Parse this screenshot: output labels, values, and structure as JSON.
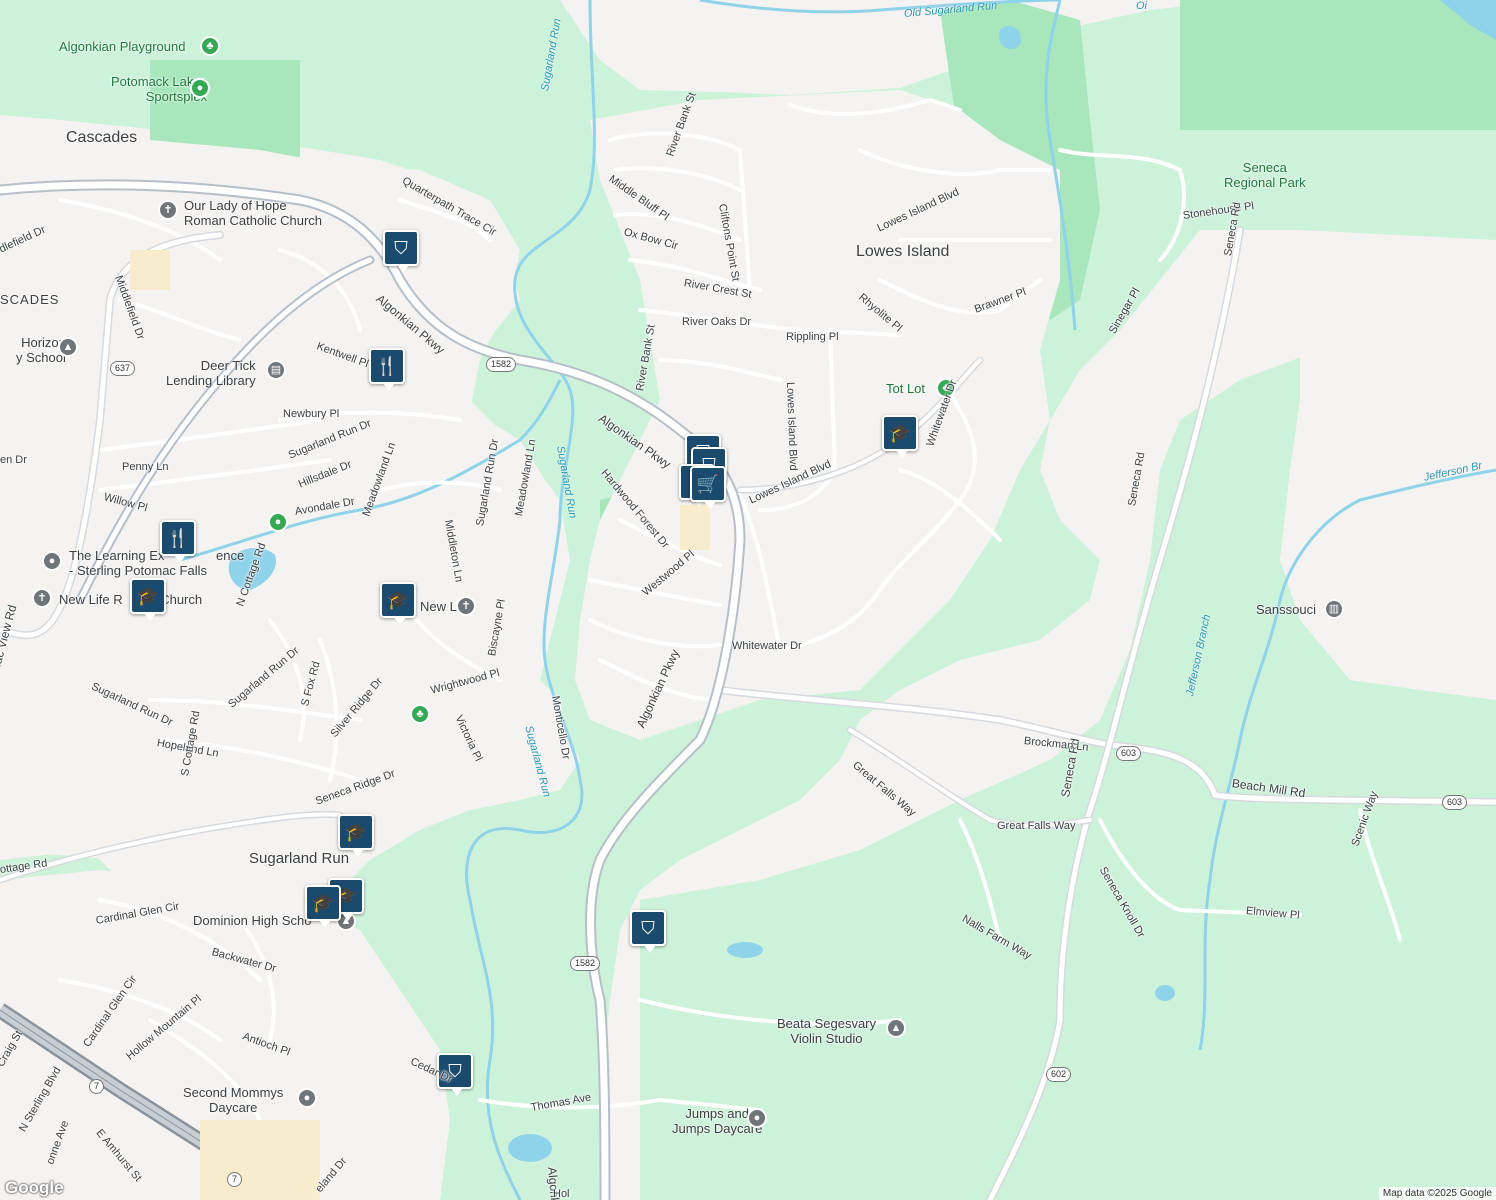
{
  "places": {
    "cascades": "Cascades",
    "cascades_partial": "SCADES",
    "lowes_island": "Lowes Island",
    "sugarland_run": "Sugarland Run"
  },
  "pois": {
    "algonkian_playground": "Algonkian Playground",
    "potomack_lakes_1": "Potomack Lakes",
    "potomack_lakes_2": "Sportsplex",
    "our_lady_1": "Our Lady of Hope",
    "our_lady_2": "Roman Catholic Church",
    "horizon_1": "Horizon",
    "horizon_2": "y School",
    "deer_tick_1": "Deer Tick",
    "deer_tick_2": "Lending Library",
    "learning_1": "The Learning Ex",
    "learning_2": "ence",
    "learning_3": "- Sterling Potomac Falls",
    "new_life_1": "New Life R",
    "new_life_2": "Church",
    "new_life_3": "New Life!",
    "tot_lot": "Tot Lot",
    "seneca_park_1": "Seneca",
    "seneca_park_2": "Regional Park",
    "sanssouci": "Sanssouci",
    "dominion": "Dominion High Scho",
    "beata_1": "Beata Segesvary",
    "beata_2": "Violin Studio",
    "second_mommys_1": "Second Mommys",
    "second_mommys_2": "Daycare",
    "jumps_1": "Jumps and",
    "jumps_2": "Jumps Daycare"
  },
  "streets": {
    "quarterpath": "Quarterpath Trace Cir",
    "algonkian_pkwy": "Algonkian Pkwy",
    "algonkian_pkwy_mid": "Algonkian Pkwy",
    "algonkian_pkwy_center": "Algonkian Pkwy",
    "algonkian_pkwy_south": "Algonkian Pkwy",
    "kentwell": "Kentwell Pl",
    "newbury": "Newbury Pl",
    "sugarland_run_dr": "Sugarland Run Dr",
    "hillsdale": "Hillsdale Dr",
    "avondale": "Avondale Dr",
    "penny": "Penny Ln",
    "willow": "Willow Pl",
    "middlefield": "Middlefield Dr",
    "middlefield_partial": "dlefield Dr",
    "en_dr": "en Dr",
    "meadowland_ln": "Meadowland Ln",
    "middleton": "Middleton Ln",
    "sugarland_run_dr_v": "Sugarland Run Dr",
    "meadowland_ln2": "Meadowland Ln",
    "n_cottage": "N Cottage Rd",
    "potomac_view": "Potomac View Rd",
    "sugarland_run_dr2": "Sugarland Run Dr",
    "sugarland_run_dr3": "Sugarland Run Dr",
    "s_fox": "S Fox Rd",
    "silver_ridge": "Silver Ridge Dr",
    "wrightwood": "Wrightwood Pl",
    "victoria": "Victoria Pl",
    "biscayne": "Biscayne Pl",
    "hopeland": "Hopeland Ln",
    "s_cottage": "S Cottage Rd",
    "seneca_ridge": "Seneca Ridge Dr",
    "cottage_rd": "ottage Rd",
    "cardinal_glen": "Cardinal Glen Cir",
    "cardinal_glen2": "Cardinal Glen Cir",
    "backwater": "Backwater Dr",
    "hollow_mountain": "Hollow Mountain Pl",
    "antioch": "Antioch Pl",
    "n_sterling": "N Sterling Blvd",
    "e_amhurst": "E Amhurst St",
    "craig": "Craig St",
    "onne_ave": "onne Ave",
    "cedar": "Cedar Dr",
    "thomas": "Thomas Ave",
    "river_bank_st": "River Bank St",
    "middle_bluff": "Middle Bluff Pl",
    "cliftons_point": "Cliftons Point St",
    "ox_bow": "Ox Bow Cir",
    "river_crest": "River Crest St",
    "river_oaks": "River Oaks Dr",
    "rippling": "Rippling Pl",
    "river_bank_st2": "River Bank St",
    "hardwood_forest": "Hardwood Forest Dr",
    "westwood": "Westwood Pl",
    "monticello": "Monticello Dr",
    "whitewater": "Whitewater Dr",
    "whitewater_v": "Whitewater Dr",
    "lowes_island_blvd": "Lowes Island Blvd",
    "lowes_island_blvd_v": "Lowes Island Blvd",
    "lowes_island_blvd_top": "Lowes Island Blvd",
    "rhyolite": "Rhyolite Pl",
    "brawner": "Brawner Pl",
    "stonehouse": "Stonehouse Pl",
    "sinegar": "Sinegar Pl",
    "seneca_rd_top": "Seneca Rd",
    "seneca_rd_mid": "Seneca Rd",
    "seneca_rd_low": "Seneca Rd",
    "brockman": "Brockman Ln",
    "beach_mill": "Beach Mill Rd",
    "great_falls_way": "Great Falls Way",
    "great_falls_way2": "Great Falls Way",
    "seneca_knoll": "Seneca Knoll Dr",
    "elmview": "Elmview Pl",
    "scenic_way": "Scenic Way",
    "nalls_farm": "Nalls Farm Way",
    "algonkian_bottom": "Algonkian Pkwy",
    "hol": "Hol",
    "eland": "eland Dr"
  },
  "water": {
    "sugarland_run_1": "Sugarland Run",
    "sugarland_run_2": "Sugarland Run",
    "sugarland_run_3": "Sugarland Run",
    "old_sugarland_run": "Old Sugarland Run",
    "jefferson_branch": "Jefferson Branch",
    "jefferson_branch_2": "Jefferson Br",
    "oi": "Oi"
  },
  "shields": {
    "r1582_a": "1582",
    "r637": "637",
    "r603_a": "603",
    "r603_b": "603",
    "r1582_b": "1582",
    "r602": "602",
    "r7_a": "7",
    "r7_b": "7"
  },
  "markers": {
    "shopping": "shopping-bag-icon",
    "restaurant": "fork-knife-icon",
    "school": "graduation-cap-icon",
    "grocery": "shopping-cart-icon"
  },
  "colors": {
    "land": "#f4f3f1",
    "park": "#c8f0d6",
    "park_dark": "#a6e3b8",
    "water": "#8fd3ea",
    "road": "#ffffff",
    "road_outline": "#d6d9de",
    "highway": "#b6bec8",
    "marker": "#1a4a6e"
  },
  "footer": {
    "google": "Google",
    "attribution": "Map data ©2025 Google"
  }
}
